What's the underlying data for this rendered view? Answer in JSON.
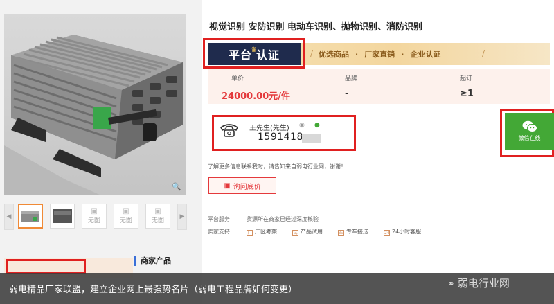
{
  "product": {
    "title": "视觉识别 安防识别 电动车识别、抛物识别、消防识别",
    "zoom_icon": "magnifier-icon"
  },
  "gallery": {
    "thumbnails": [
      {
        "label": ""
      },
      {
        "label": ""
      },
      {
        "label": "无图"
      },
      {
        "label": "无图"
      },
      {
        "label": "无图"
      }
    ]
  },
  "certification": {
    "badge_text_1": "平台",
    "badge_text_2": "认证",
    "items": [
      "优选商品",
      "厂家直销",
      "企业认证"
    ]
  },
  "price": {
    "unit_price_label": "单价",
    "unit_price_value": "24000.00元/件",
    "brand_label": "品牌",
    "brand_value": "-",
    "moq_label": "起订",
    "moq_value": "≥1"
  },
  "contact": {
    "name": "王先生(先生)",
    "phone": "1591418"
  },
  "wechat": {
    "label": "微信在线"
  },
  "hint_text": "了解更多信息联系我时，请告知来自弱电行业网，谢谢！",
  "inquire_button": "询问底价",
  "services": {
    "platform_label": "平台服务",
    "platform_value": "货源所在商家已经过深度核验",
    "seller_label": "卖家支持",
    "seller_items": [
      "厂区考察",
      "产品试用",
      "专车接送",
      "24小时客服"
    ]
  },
  "merchant_section": "商家产品",
  "caption": "弱电精品厂家联盟，建立企业网上最强势名片（弱电工程品牌如何变更）",
  "watermark": "弱电行业网",
  "colors": {
    "accent_red": "#e4393c",
    "highlight_red": "#e02020",
    "badge_navy": "#1f2b4d",
    "wechat_green": "#43a836",
    "gold_band": "#f3d69e"
  }
}
